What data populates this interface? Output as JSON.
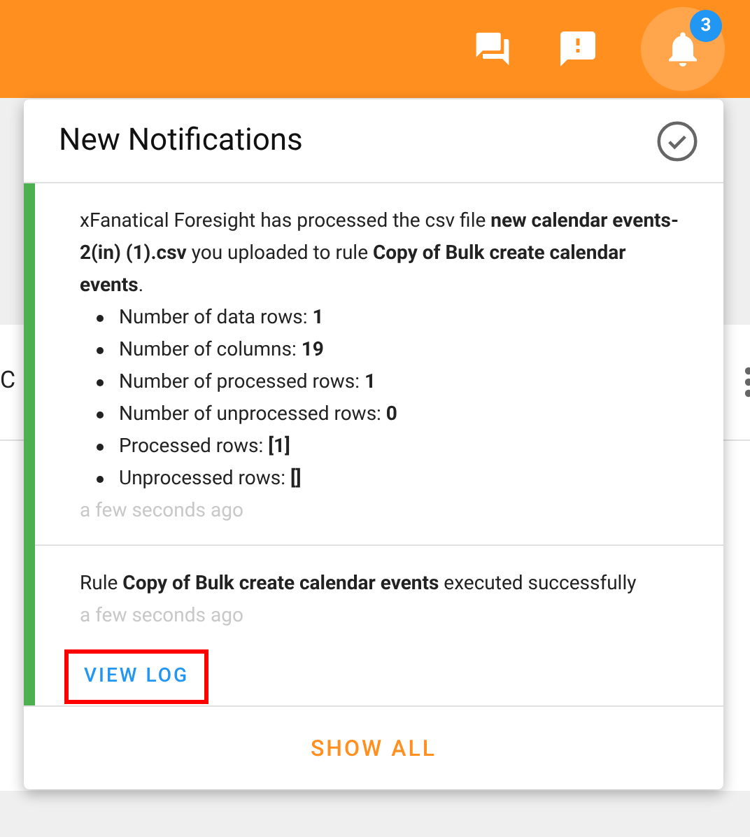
{
  "header": {
    "badge": "3"
  },
  "background": {
    "row_text": "C"
  },
  "panel": {
    "title": "New Notifications",
    "notifications": [
      {
        "kind": "upload",
        "text": "xFanatical Foresight has processed the csv file **new calendar events-2(in) (1).csv** you uploaded to rule **Copy of Bulk create calendar events**.",
        "bullets": [
          "Number of data rows: **1**",
          "Number of columns: **19**",
          "Number of processed rows: **1**",
          "Number of unprocessed rows: **0**",
          "Processed rows: **[1]**",
          "Unprocessed rows: **[]**"
        ],
        "time": "a few seconds ago"
      },
      {
        "kind": "rule",
        "text": "Rule **Copy of Bulk create calendar events** executed successfully",
        "time": "a few seconds ago",
        "action": "VIEW LOG",
        "highlighted": true
      }
    ],
    "footer": "SHOW ALL"
  }
}
